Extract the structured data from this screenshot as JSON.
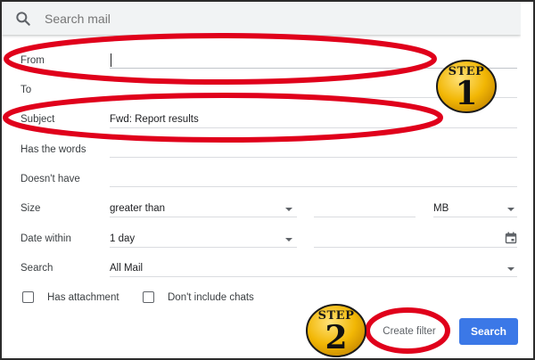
{
  "search": {
    "placeholder": "Search mail"
  },
  "form": {
    "from_label": "From",
    "to_label": "To",
    "subject_label": "Subject",
    "subject_value": "Fwd: Report results",
    "has_words_label": "Has the words",
    "doesnt_have_label": "Doesn't have",
    "size_label": "Size",
    "size_operator": "greater than",
    "size_unit": "MB",
    "date_within_label": "Date within",
    "date_within_value": "1 day",
    "search_label": "Search",
    "search_scope": "All Mail",
    "has_attachment_label": "Has attachment",
    "dont_include_chats_label": "Don't include chats"
  },
  "buttons": {
    "create_filter": "Create filter",
    "search": "Search"
  },
  "annotations": {
    "step_word": "STEP",
    "step1_number": "1",
    "step2_number": "2"
  },
  "colors": {
    "highlight_red": "#e0001b",
    "badge_gold": "#f2b705",
    "search_blue": "#3b78e7"
  }
}
